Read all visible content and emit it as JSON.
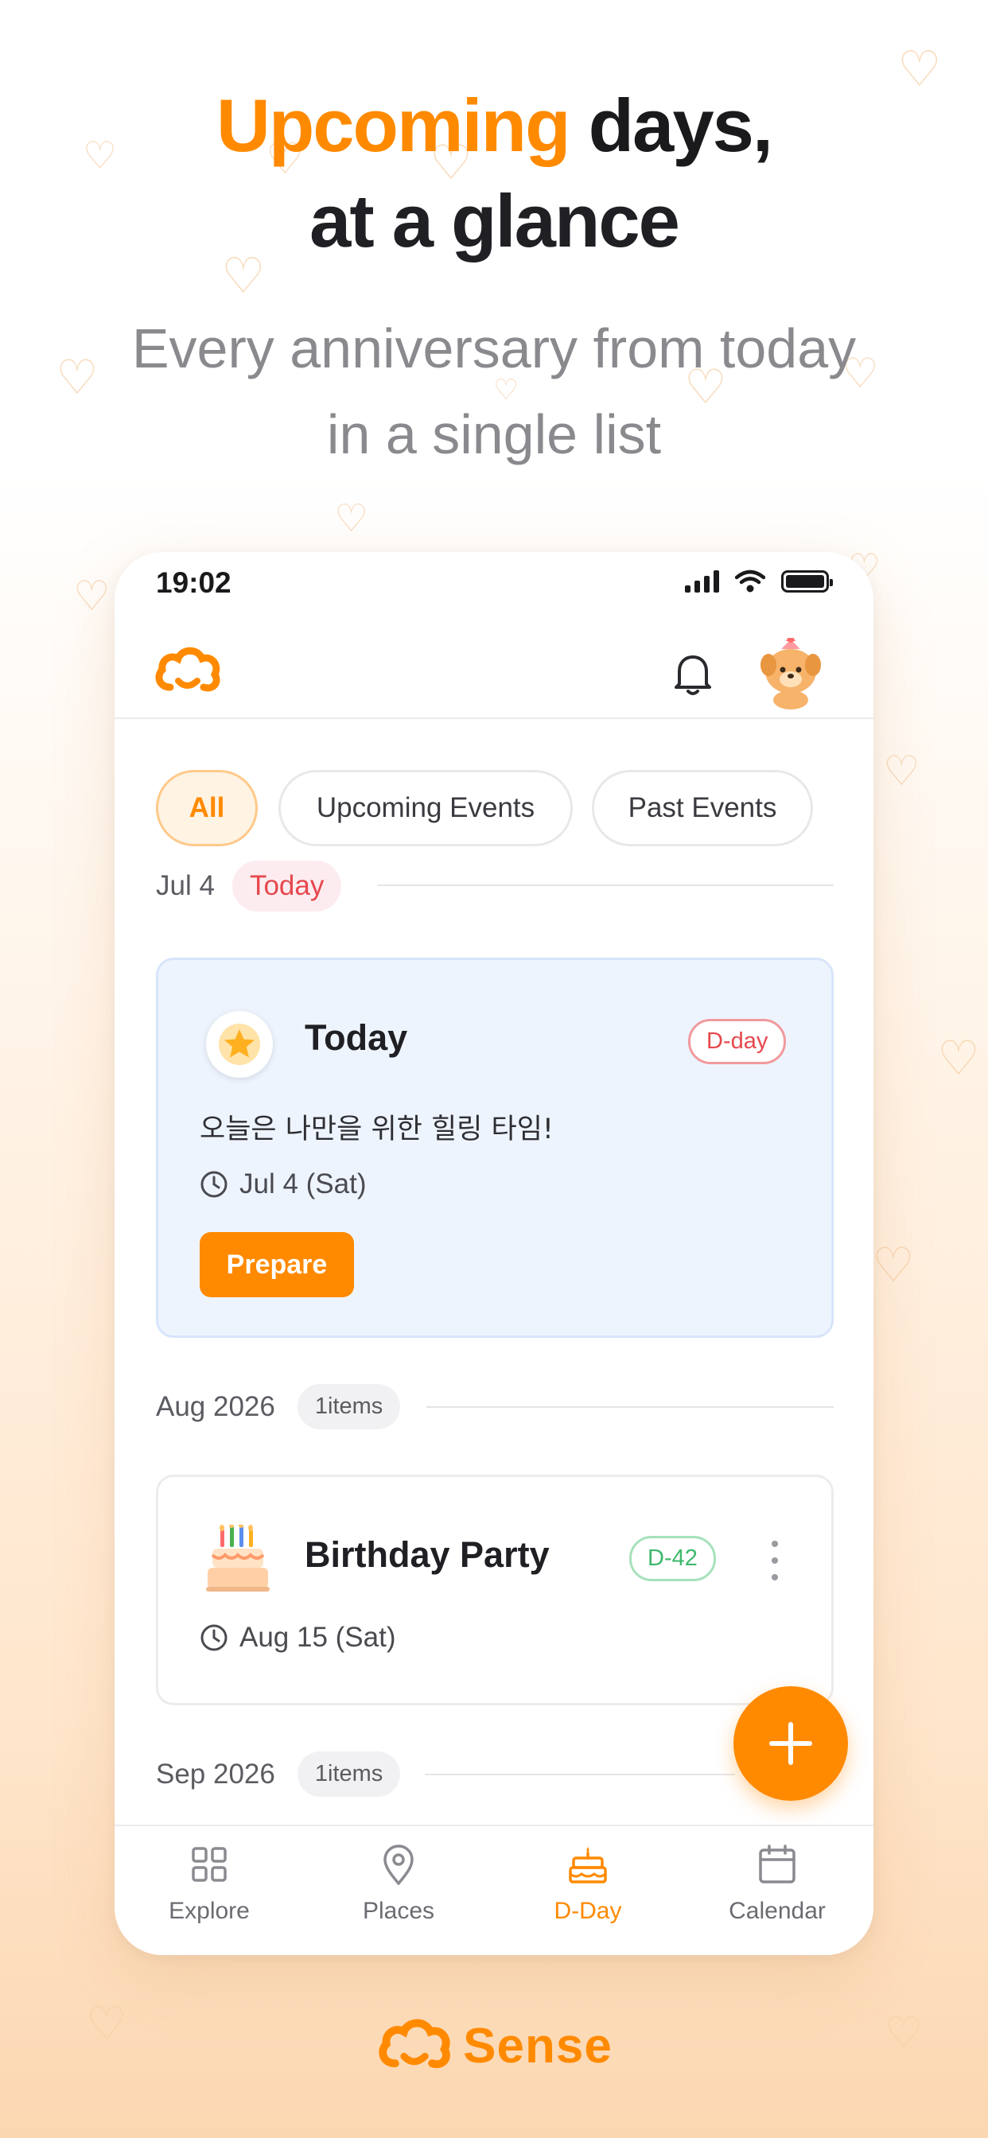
{
  "hero": {
    "headline_accent": "Upcoming",
    "headline_rest": " days,",
    "headline_line2": "at a glance",
    "subline_line1": "Every anniversary from today",
    "subline_line2": "in a single list"
  },
  "status_bar": {
    "time": "19:02"
  },
  "filters": {
    "tabs": [
      "All",
      "Upcoming Events",
      "Past Events"
    ],
    "active": "All"
  },
  "groups": [
    {
      "label": "Jul 4",
      "badge": "Today",
      "events": [
        {
          "icon": "star-icon",
          "title": "Today",
          "dday": "D-day",
          "description": "오늘은 나만을 위한 힐링 타임!",
          "date": "Jul 4 (Sat)",
          "action": "Prepare"
        }
      ]
    },
    {
      "label": "Aug 2026",
      "badge": "1items",
      "events": [
        {
          "icon": "cake-icon",
          "title": "Birthday Party",
          "dday": "D-42",
          "date": "Aug 15 (Sat)"
        }
      ]
    },
    {
      "label": "Sep 2026",
      "badge": "1items",
      "events": []
    }
  ],
  "bottom_nav": {
    "items": [
      {
        "label": "Explore",
        "icon": "grid-icon"
      },
      {
        "label": "Places",
        "icon": "map-pin-icon"
      },
      {
        "label": "D-Day",
        "icon": "cake-icon"
      },
      {
        "label": "Calendar",
        "icon": "calendar-icon"
      }
    ],
    "active": "D-Day"
  },
  "brand": {
    "name": "Sense"
  },
  "colors": {
    "accent": "#ff8a00",
    "danger": "#e5484d",
    "success": "#3eb86b",
    "today_card_bg": "#eef4fe"
  }
}
